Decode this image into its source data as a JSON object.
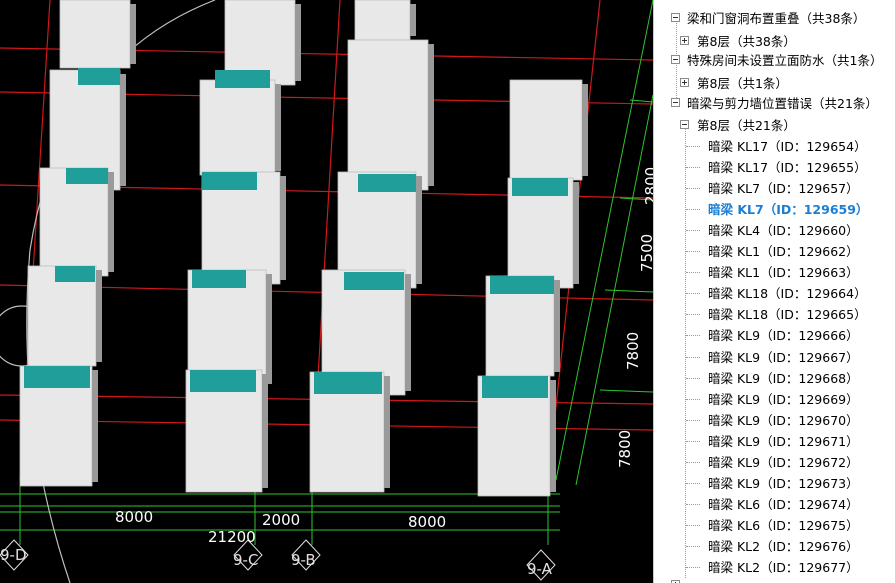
{
  "viewport": {
    "dimensions": [
      "8000",
      "2000",
      "8000",
      "21200",
      "7800",
      "7800",
      "7500",
      "2800"
    ],
    "axes": [
      "9-D",
      "9-C",
      "9-B",
      "9-A"
    ]
  },
  "tree": {
    "top_partial": "",
    "groups": [
      {
        "label": "梁和门窗洞布置重叠（共38条）",
        "state": "expanded",
        "children": [
          {
            "label": "第8层（共38条）",
            "state": "collapsed"
          }
        ]
      },
      {
        "label": "特殊房间未设置立面防水（共1条）",
        "state": "expanded",
        "children": [
          {
            "label": "第8层（共1条）",
            "state": "collapsed"
          }
        ]
      },
      {
        "label": "暗梁与剪力墙位置错误（共21条）",
        "state": "expanded",
        "children": [
          {
            "label": "第8层（共21条）",
            "state": "expanded"
          }
        ]
      }
    ],
    "items": [
      "暗梁 KL17（ID：129654）",
      "暗梁 KL17（ID：129655）",
      "暗梁 KL7（ID：129657）",
      "暗梁 KL7（ID：129659）",
      "暗梁 KL4（ID：129660）",
      "暗梁 KL1（ID：129662）",
      "暗梁 KL1（ID：129663）",
      "暗梁 KL18（ID：129664）",
      "暗梁 KL18（ID：129665）",
      "暗梁 KL9（ID：129666）",
      "暗梁 KL9（ID：129667）",
      "暗梁 KL9（ID：129668）",
      "暗梁 KL9（ID：129669）",
      "暗梁 KL9（ID：129670）",
      "暗梁 KL9（ID：129671）",
      "暗梁 KL9（ID：129672）",
      "暗梁 KL9（ID：129673）",
      "暗梁 KL6（ID：129674）",
      "暗梁 KL6（ID：129675）",
      "暗梁 KL2（ID：129676）",
      "暗梁 KL2（ID：129677）"
    ],
    "selected_index": 3,
    "selected_color": "#1a7fd4",
    "bottom_partial": ""
  },
  "colors": {
    "beam_teal": "#1f9e9a",
    "wall": "#e8e8e8",
    "grid_red": "#d01818",
    "grid_green": "#2ec42e"
  }
}
